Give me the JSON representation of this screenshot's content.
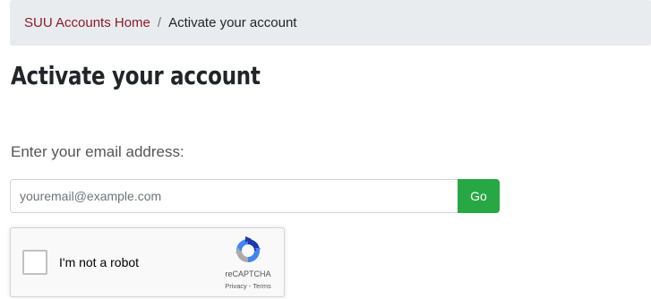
{
  "breadcrumb": {
    "home": "SUU Accounts Home",
    "separator": "/",
    "current": "Activate your account"
  },
  "page": {
    "title": "Activate your account"
  },
  "form": {
    "email_label": "Enter your email address:",
    "email_placeholder": "youremail@example.com",
    "email_value": "",
    "go_label": "Go"
  },
  "recaptcha": {
    "label": "I'm not a robot",
    "brand": "reCAPTCHA",
    "privacy": "Privacy",
    "links_separator": "-",
    "terms": "Terms",
    "logo_icon": "recaptcha-logo-icon"
  },
  "colors": {
    "link": "#8c1a2b",
    "breadcrumb_bg": "#e9ecef",
    "button_green": "#28a745"
  }
}
